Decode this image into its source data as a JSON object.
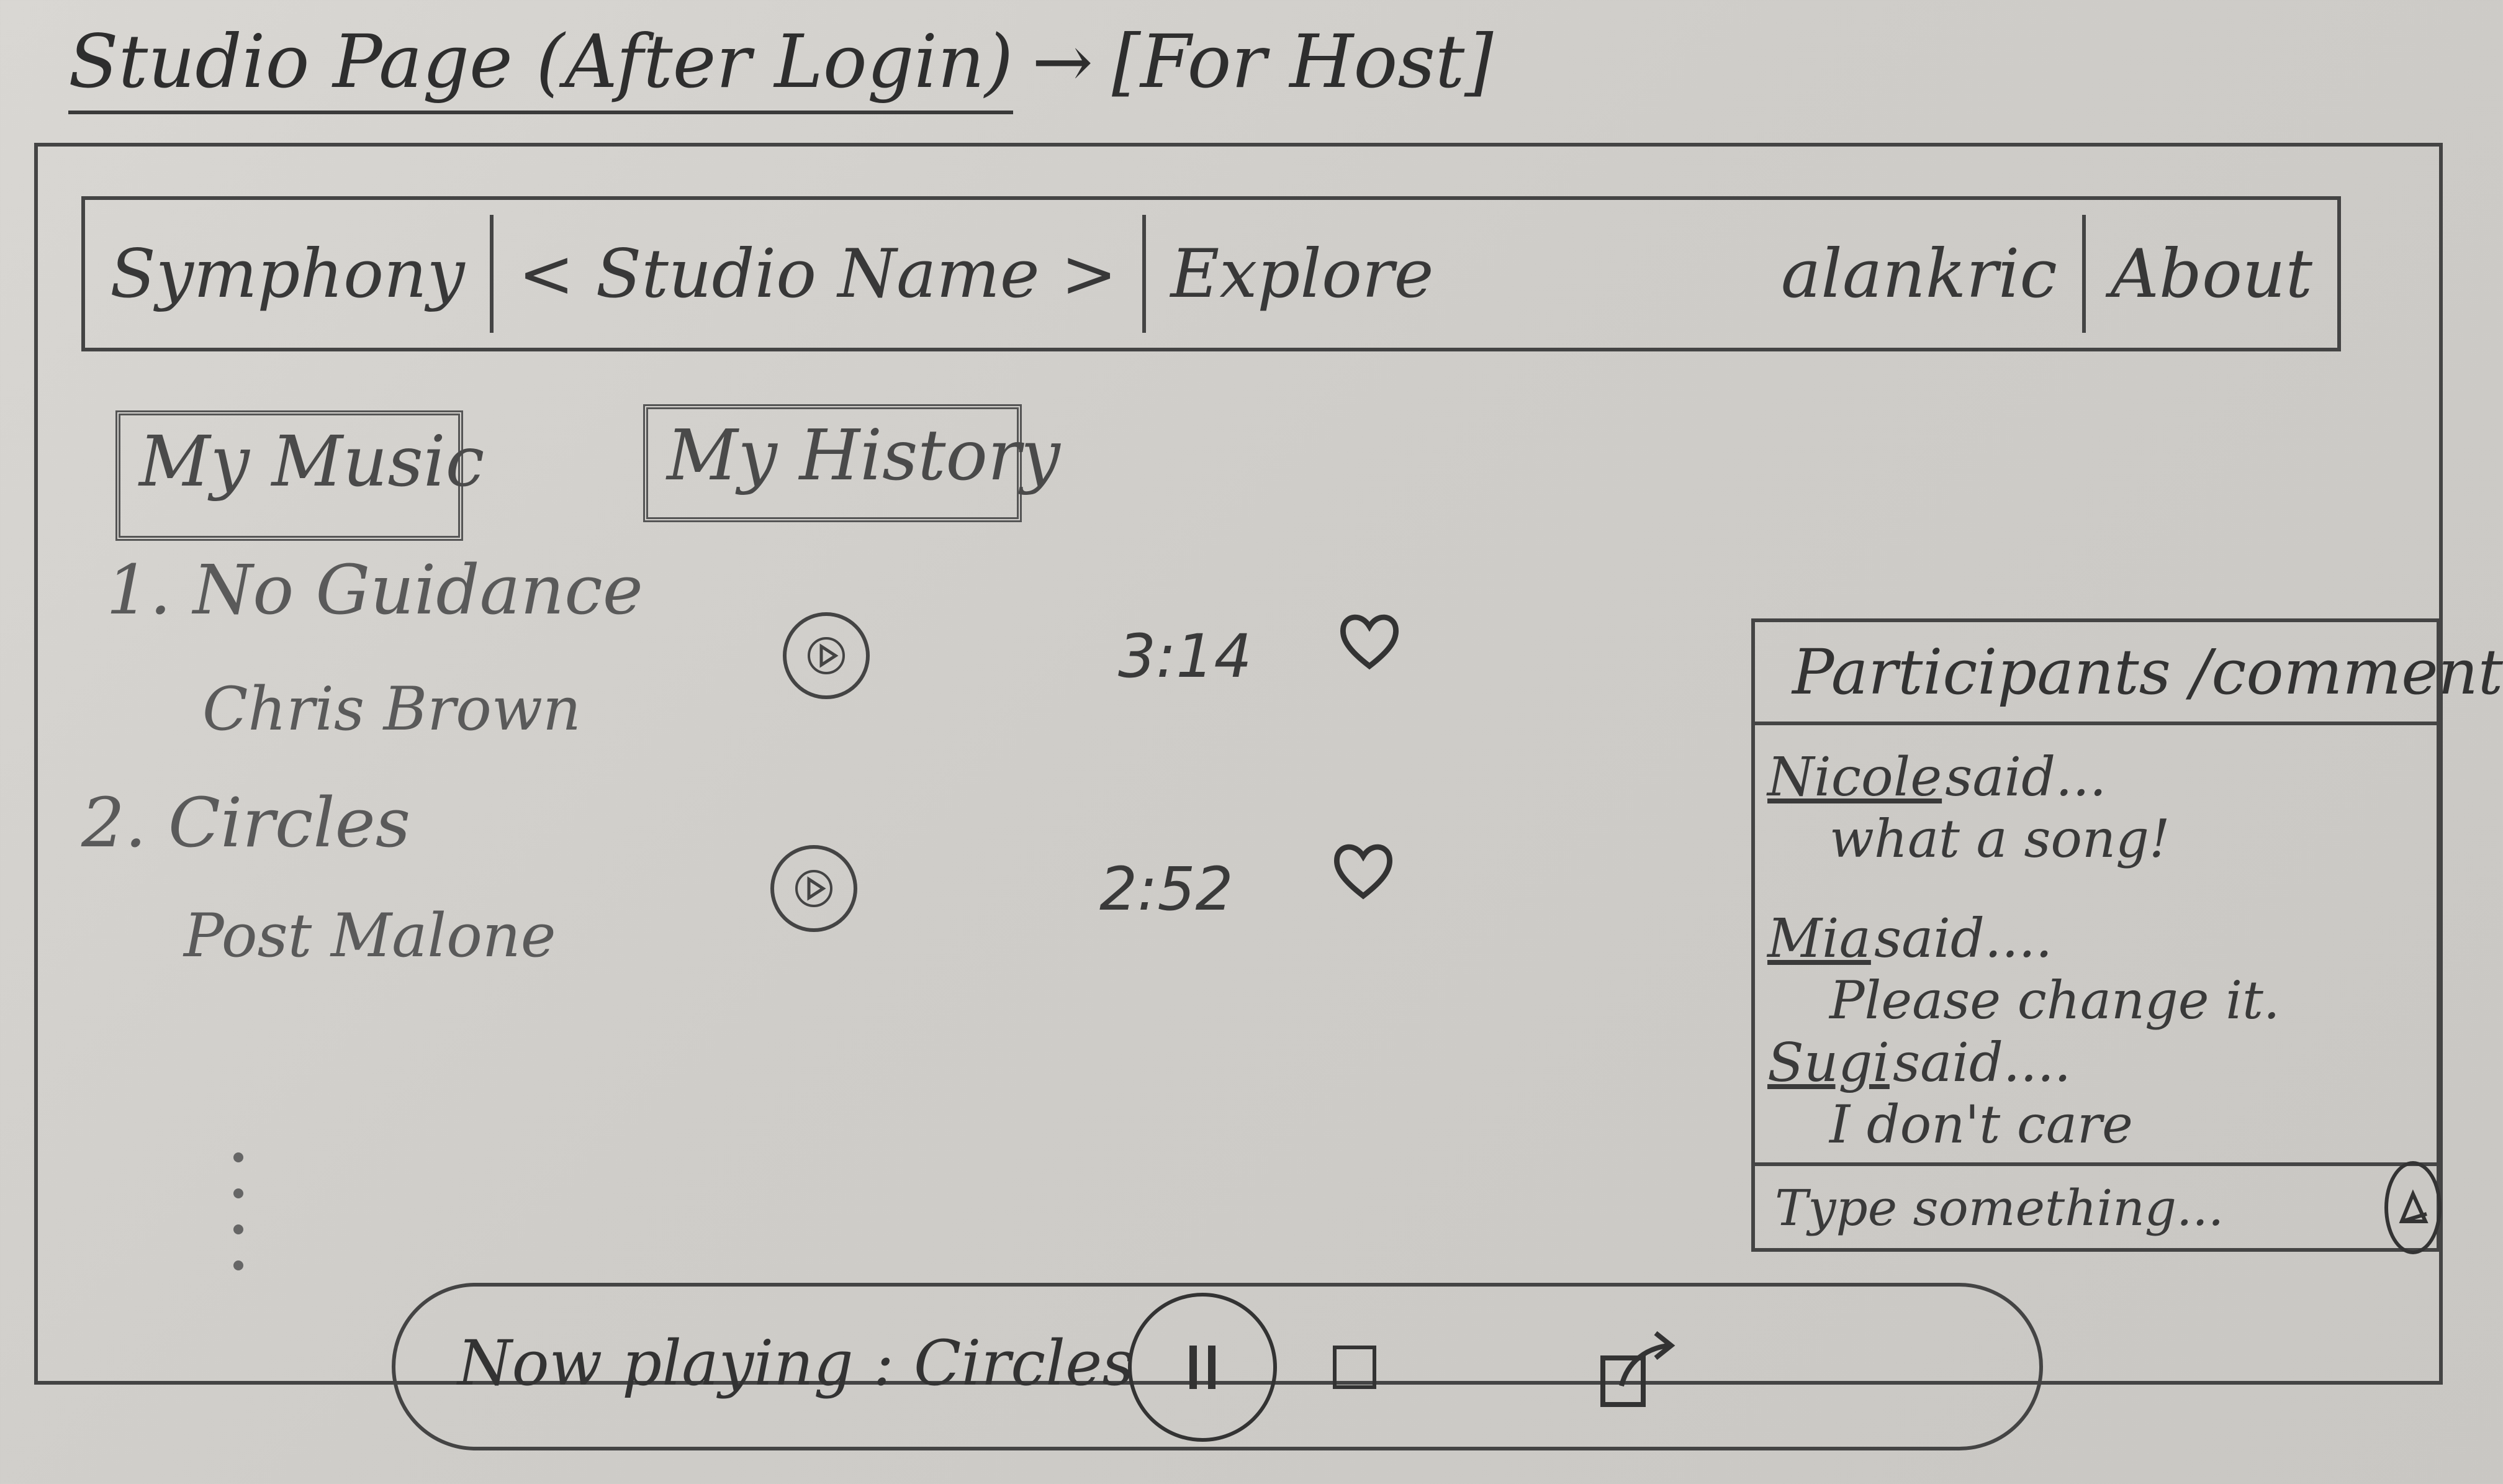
{
  "page_title": {
    "main": "Studio Page (After Login)",
    "arrow": "→",
    "suffix": "[For Host]"
  },
  "navbar": {
    "brand": "Symphony",
    "studio_name": "< Studio Name >",
    "explore": "Explore",
    "username": "alankric",
    "about": "About"
  },
  "tabs": {
    "my_music": "My Music",
    "my_history": "My History"
  },
  "songs": [
    {
      "index": "1.",
      "title": "No Guidance",
      "artist": "Chris Brown",
      "duration": "3:14"
    },
    {
      "index": "2.",
      "title": "Circles",
      "artist": "Post Malone",
      "duration": "2:52"
    }
  ],
  "comments_panel": {
    "header": "Participants /comments",
    "comments": [
      {
        "author": "Nicole",
        "said": "said...",
        "text": "what a song!"
      },
      {
        "author": "Mia",
        "said": "said....",
        "text": "Please change it."
      },
      {
        "author": "Sugi",
        "said": "said....",
        "text": "I don't care"
      }
    ],
    "input_placeholder": "Type something..."
  },
  "now_playing": {
    "label": "Now playing : Circles"
  },
  "icons": {
    "play": "play-icon",
    "heart": "heart-icon",
    "pause": "pause-icon",
    "stop": "stop-icon",
    "share": "share-icon",
    "send": "send-icon"
  }
}
